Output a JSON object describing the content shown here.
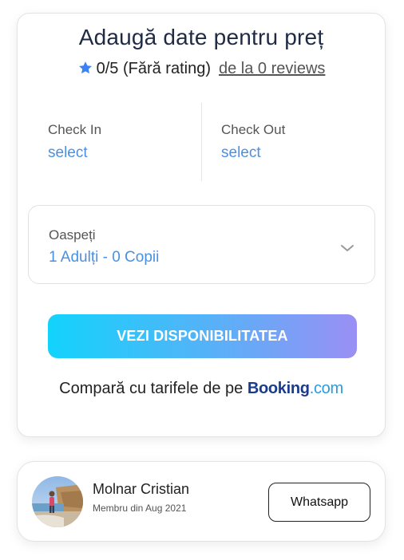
{
  "booking_card": {
    "title": "Adaugă date pentru preț",
    "rating": {
      "icon": "star-icon",
      "star_color": "#3b82f6",
      "score": "0/5 (Fără rating)",
      "reviews_link": "de la 0 reviews"
    },
    "check_in": {
      "label": "Check In",
      "value": "select"
    },
    "check_out": {
      "label": "Check Out",
      "value": "select"
    },
    "guests": {
      "label": "Oaspeți",
      "value": "1 Adulți - 0 Copii",
      "icon": "chevron-down-icon"
    },
    "cta_label": "VEZI DISPONIBILITATEA",
    "compare": {
      "text": "Compară cu tarifele de pe",
      "brand_main": "Booking",
      "brand_suffix": ".com"
    },
    "accent_color": "#4a90e2"
  },
  "host_card": {
    "name": "Molnar Cristian",
    "member_since": "Membru din Aug 2021",
    "contact_button": "Whatsapp",
    "avatar_icon": "avatar-photo"
  }
}
